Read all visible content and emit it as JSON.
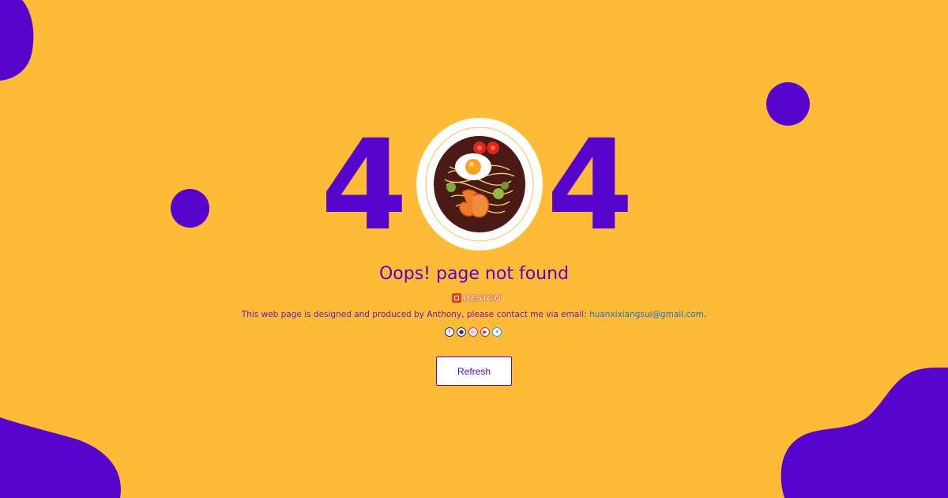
{
  "error": {
    "digit_left": "4",
    "digit_right": "4",
    "title": "Oops! page not found"
  },
  "brand": {
    "text": "DESIGN"
  },
  "footer": {
    "description": "This web page is designed and produced by Anthony, please contact me via email: ",
    "email": "huanxixiangsui@gmail.com",
    "trailing": "."
  },
  "socials": [
    {
      "icon": "facebook-icon",
      "glyph": "f"
    },
    {
      "icon": "github-icon",
      "glyph": "●"
    },
    {
      "icon": "instagram-icon",
      "glyph": "◎"
    },
    {
      "icon": "youtube-icon",
      "glyph": "▶"
    },
    {
      "icon": "twitter-icon",
      "glyph": "✦"
    }
  ],
  "actions": {
    "refresh_label": "Refresh"
  },
  "colors": {
    "background": "#fdbb38",
    "accent": "#5603cb",
    "link": "#1a6fd8"
  }
}
